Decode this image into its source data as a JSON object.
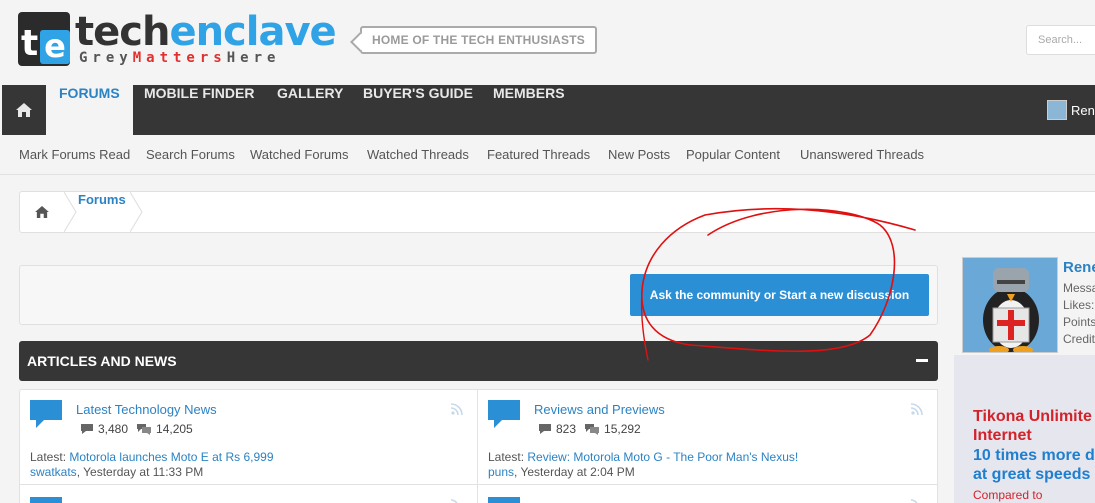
{
  "header": {
    "logo": {
      "mark_t": "t",
      "mark_e": "e",
      "word_tech": "tech",
      "word_enclave": "enclave",
      "tag_grey": "Grey",
      "tag_matters": "Matters",
      "tag_here": "Here"
    },
    "tagline": "HOME OF THE TECH ENTHUSIASTS",
    "search_placeholder": "Search..."
  },
  "main_nav": {
    "items": [
      {
        "label": "FORUMS",
        "active": true
      },
      {
        "label": "MOBILE FINDER",
        "active": false
      },
      {
        "label": "GALLERY",
        "active": false
      },
      {
        "label": "BUYER'S GUIDE",
        "active": false
      },
      {
        "label": "MEMBERS",
        "active": false
      }
    ],
    "user_name": "Ren"
  },
  "sub_nav": {
    "items": [
      "Mark Forums Read",
      "Search Forums",
      "Watched Forums",
      "Watched Threads",
      "Featured Threads",
      "New Posts",
      "Popular Content",
      "Unanswered Threads"
    ]
  },
  "breadcrumb": {
    "items": [
      "Forums"
    ]
  },
  "cta": {
    "button_label": "Ask the community or Start a new discussion"
  },
  "category": {
    "title": "ARTICLES AND NEWS",
    "forums": [
      {
        "title": "Latest Technology News",
        "threads": "3,480",
        "messages": "14,205",
        "latest_prefix": "Latest:",
        "latest_thread": "Motorola launches Moto E at Rs 6,999",
        "latest_user": "swatkats",
        "latest_time": "Yesterday at 11:33 PM"
      },
      {
        "title": "Reviews and Previews",
        "threads": "823",
        "messages": "15,292",
        "latest_prefix": "Latest:",
        "latest_thread": "Review: Motorola Moto G - The Poor Man's Nexus!",
        "latest_user": "puns",
        "latest_time": "Yesterday at 2:04 PM"
      }
    ]
  },
  "sidebar": {
    "visitor": {
      "name": "Rene",
      "stats": [
        "Messa",
        "Likes:",
        "Points",
        "Credit"
      ]
    },
    "ad": {
      "line1": "Tikona Unlimite",
      "line2": "Internet",
      "line3": "10 times more d",
      "line4": "at great speeds",
      "small": "Compared to"
    }
  },
  "colors": {
    "accent": "#2b83c4",
    "nav_bg": "#363636",
    "button_bg": "#2b8fd6",
    "annotation_red": "#e01010"
  },
  "icons": {
    "home": "home-icon",
    "forum": "speech-bubble-icon",
    "rss": "rss-icon",
    "threads": "comment-icon",
    "messages": "comments-icon",
    "collapse": "minus-icon"
  }
}
